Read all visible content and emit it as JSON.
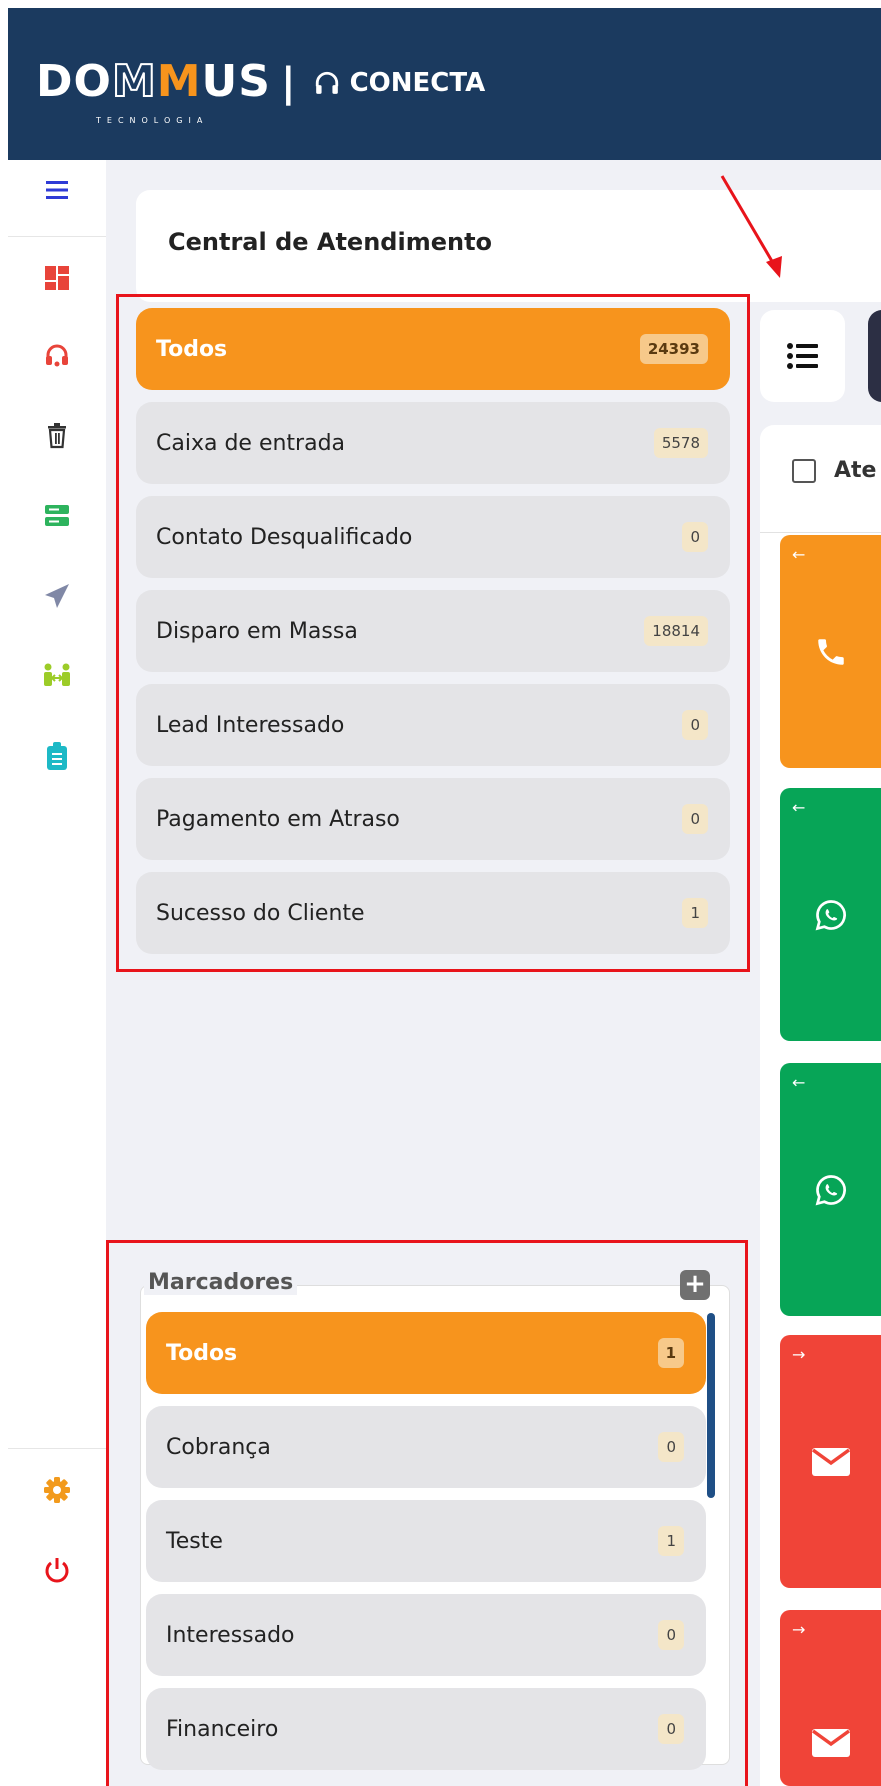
{
  "header": {
    "logo_word_a": "DO",
    "logo_word_m1": "M",
    "logo_word_m2": "M",
    "logo_word_b": "US",
    "logo_sub": "TECNOLOGIA",
    "separator": "|",
    "product": "CONECTA"
  },
  "sidebar": {
    "items": [
      {
        "icon": "hamburger-menu-icon",
        "color": "#2f3bd6"
      },
      {
        "icon": "dashboard-icon",
        "color": "#e8443a"
      },
      {
        "icon": "headset-icon",
        "color": "#e8443a"
      },
      {
        "icon": "trash-icon",
        "color": "#333333"
      },
      {
        "icon": "server-icon",
        "color": "#2db35d"
      },
      {
        "icon": "paper-plane-icon",
        "color": "#8088a6"
      },
      {
        "icon": "people-exchange-icon",
        "color": "#9ccc28"
      },
      {
        "icon": "clipboard-icon",
        "color": "#1db9c6"
      },
      {
        "icon": "gear-icon",
        "color": "#f29a1c"
      },
      {
        "icon": "power-icon",
        "color": "#e8141b"
      }
    ]
  },
  "main": {
    "title": "Central de Atendimento",
    "table_header": "Ate",
    "categories": [
      {
        "label": "Todos",
        "count": "24393",
        "active": true
      },
      {
        "label": "Caixa de entrada",
        "count": "5578"
      },
      {
        "label": "Contato Desqualificado",
        "count": "0"
      },
      {
        "label": "Disparo em Massa",
        "count": "18814"
      },
      {
        "label": "Lead Interessado",
        "count": "0"
      },
      {
        "label": "Pagamento em Atraso",
        "count": "0"
      },
      {
        "label": "Sucesso do Cliente",
        "count": "1"
      }
    ],
    "markers": {
      "title": "Marcadores",
      "add_label": "+",
      "items": [
        {
          "label": "Todos",
          "count": "1",
          "active": true
        },
        {
          "label": "Cobrança",
          "count": "0"
        },
        {
          "label": "Teste",
          "count": "1"
        },
        {
          "label": "Interessado",
          "count": "0"
        },
        {
          "label": "Financeiro",
          "count": "0"
        }
      ]
    },
    "cards": [
      {
        "channel": "phone-icon",
        "color": "#f7941d",
        "direction": "←"
      },
      {
        "channel": "whatsapp-icon",
        "color": "#07a557",
        "direction": "←"
      },
      {
        "channel": "whatsapp-icon",
        "color": "#07a557",
        "direction": "←"
      },
      {
        "channel": "envelope-icon",
        "color": "#f04438",
        "direction": "→"
      },
      {
        "channel": "envelope-icon",
        "color": "#f04438",
        "direction": "→"
      }
    ]
  },
  "colors": {
    "header_bg": "#1b3a5f",
    "accent_orange": "#f7941d",
    "highlight_red": "#e8141b",
    "main_bg": "#f0f1f6"
  }
}
